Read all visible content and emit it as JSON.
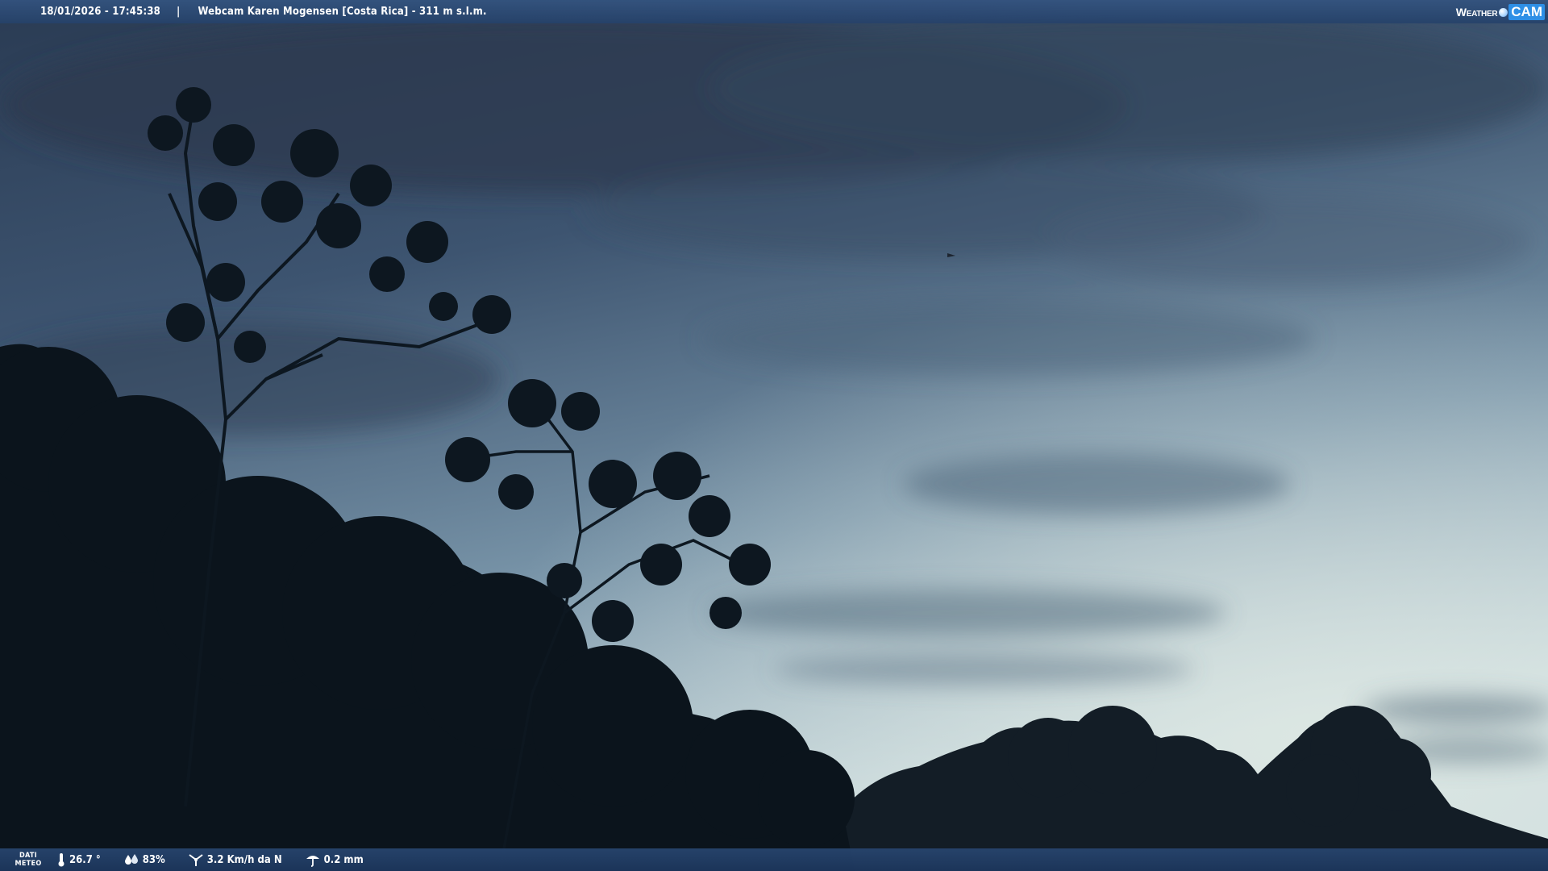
{
  "header": {
    "timestamp": "18/01/2026 - 17:45:38",
    "separator": "|",
    "location": "Webcam Karen Mogensen [Costa Rica]  - 311 m s.l.m.",
    "brand_prefix": "Weather",
    "brand_suffix": "CAM"
  },
  "weather": {
    "label_line1": "DATI",
    "label_line2": "METEO",
    "temperature": "26.7 °",
    "humidity": "83%",
    "wind": "3.2 Km/h da N",
    "rain": "0.2 mm"
  },
  "icons": {
    "temperature": "thermometer-icon",
    "humidity": "humidity-drops-icon",
    "wind": "wind-icon",
    "rain": "rain-gauge-icon",
    "brand": "weathercam-logo-icon"
  },
  "colors": {
    "bar_top": "#34547f",
    "bar_bottom": "#1c365c",
    "sky_top": "#2c3e57",
    "sky_horizon": "#c3d6dc",
    "vegetation": "#0b141c"
  }
}
